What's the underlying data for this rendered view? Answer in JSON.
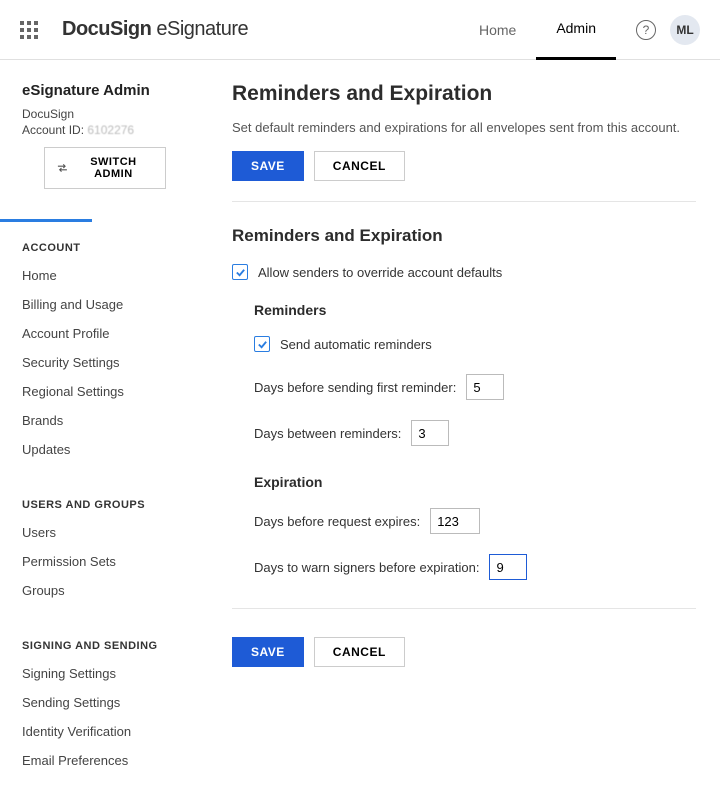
{
  "header": {
    "logo_main": "DocuSign",
    "logo_sub": " eSignature",
    "nav": {
      "home": "Home",
      "admin": "Admin"
    },
    "avatar": "ML"
  },
  "sidebar": {
    "title": "eSignature Admin",
    "org": "DocuSign",
    "account_label": "Account ID: ",
    "account_id": "6102276",
    "switch": "SWITCH ADMIN",
    "sections": {
      "account": {
        "title": "ACCOUNT",
        "items": [
          "Home",
          "Billing and Usage",
          "Account Profile",
          "Security Settings",
          "Regional Settings",
          "Brands",
          "Updates"
        ]
      },
      "users": {
        "title": "USERS AND GROUPS",
        "items": [
          "Users",
          "Permission Sets",
          "Groups"
        ]
      },
      "signing": {
        "title": "SIGNING AND SENDING",
        "items": [
          "Signing Settings",
          "Sending Settings",
          "Identity Verification",
          "Email Preferences"
        ]
      }
    }
  },
  "main": {
    "title": "Reminders and Expiration",
    "desc": "Set default reminders and expirations for all envelopes sent from this account.",
    "save": "SAVE",
    "cancel": "CANCEL",
    "section_title": "Reminders and Expiration",
    "allow_override": "Allow senders to override account defaults",
    "reminders": {
      "title": "Reminders",
      "send_auto": "Send automatic reminders",
      "first_label": "Days before sending first reminder:",
      "first_value": "5",
      "between_label": "Days between reminders:",
      "between_value": "3"
    },
    "expiration": {
      "title": "Expiration",
      "expires_label": "Days before request expires:",
      "expires_value": "123",
      "warn_label": "Days to warn signers before expiration:",
      "warn_value": "9"
    }
  }
}
